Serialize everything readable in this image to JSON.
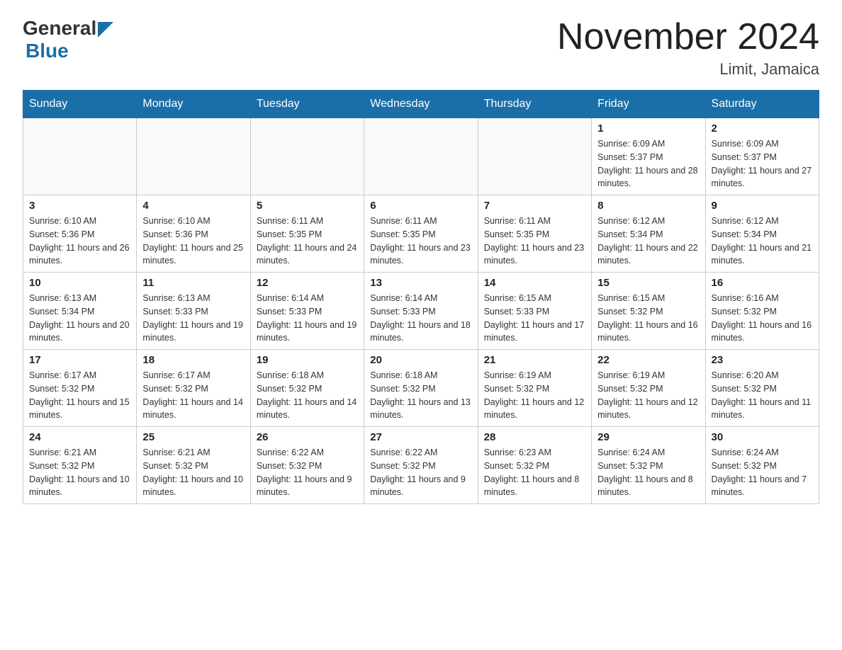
{
  "header": {
    "logo_general": "General",
    "logo_blue": "Blue",
    "month_title": "November 2024",
    "location": "Limit, Jamaica"
  },
  "weekdays": [
    "Sunday",
    "Monday",
    "Tuesday",
    "Wednesday",
    "Thursday",
    "Friday",
    "Saturday"
  ],
  "weeks": [
    [
      {
        "day": "",
        "sunrise": "",
        "sunset": "",
        "daylight": ""
      },
      {
        "day": "",
        "sunrise": "",
        "sunset": "",
        "daylight": ""
      },
      {
        "day": "",
        "sunrise": "",
        "sunset": "",
        "daylight": ""
      },
      {
        "day": "",
        "sunrise": "",
        "sunset": "",
        "daylight": ""
      },
      {
        "day": "",
        "sunrise": "",
        "sunset": "",
        "daylight": ""
      },
      {
        "day": "1",
        "sunrise": "Sunrise: 6:09 AM",
        "sunset": "Sunset: 5:37 PM",
        "daylight": "Daylight: 11 hours and 28 minutes."
      },
      {
        "day": "2",
        "sunrise": "Sunrise: 6:09 AM",
        "sunset": "Sunset: 5:37 PM",
        "daylight": "Daylight: 11 hours and 27 minutes."
      }
    ],
    [
      {
        "day": "3",
        "sunrise": "Sunrise: 6:10 AM",
        "sunset": "Sunset: 5:36 PM",
        "daylight": "Daylight: 11 hours and 26 minutes."
      },
      {
        "day": "4",
        "sunrise": "Sunrise: 6:10 AM",
        "sunset": "Sunset: 5:36 PM",
        "daylight": "Daylight: 11 hours and 25 minutes."
      },
      {
        "day": "5",
        "sunrise": "Sunrise: 6:11 AM",
        "sunset": "Sunset: 5:35 PM",
        "daylight": "Daylight: 11 hours and 24 minutes."
      },
      {
        "day": "6",
        "sunrise": "Sunrise: 6:11 AM",
        "sunset": "Sunset: 5:35 PM",
        "daylight": "Daylight: 11 hours and 23 minutes."
      },
      {
        "day": "7",
        "sunrise": "Sunrise: 6:11 AM",
        "sunset": "Sunset: 5:35 PM",
        "daylight": "Daylight: 11 hours and 23 minutes."
      },
      {
        "day": "8",
        "sunrise": "Sunrise: 6:12 AM",
        "sunset": "Sunset: 5:34 PM",
        "daylight": "Daylight: 11 hours and 22 minutes."
      },
      {
        "day": "9",
        "sunrise": "Sunrise: 6:12 AM",
        "sunset": "Sunset: 5:34 PM",
        "daylight": "Daylight: 11 hours and 21 minutes."
      }
    ],
    [
      {
        "day": "10",
        "sunrise": "Sunrise: 6:13 AM",
        "sunset": "Sunset: 5:34 PM",
        "daylight": "Daylight: 11 hours and 20 minutes."
      },
      {
        "day": "11",
        "sunrise": "Sunrise: 6:13 AM",
        "sunset": "Sunset: 5:33 PM",
        "daylight": "Daylight: 11 hours and 19 minutes."
      },
      {
        "day": "12",
        "sunrise": "Sunrise: 6:14 AM",
        "sunset": "Sunset: 5:33 PM",
        "daylight": "Daylight: 11 hours and 19 minutes."
      },
      {
        "day": "13",
        "sunrise": "Sunrise: 6:14 AM",
        "sunset": "Sunset: 5:33 PM",
        "daylight": "Daylight: 11 hours and 18 minutes."
      },
      {
        "day": "14",
        "sunrise": "Sunrise: 6:15 AM",
        "sunset": "Sunset: 5:33 PM",
        "daylight": "Daylight: 11 hours and 17 minutes."
      },
      {
        "day": "15",
        "sunrise": "Sunrise: 6:15 AM",
        "sunset": "Sunset: 5:32 PM",
        "daylight": "Daylight: 11 hours and 16 minutes."
      },
      {
        "day": "16",
        "sunrise": "Sunrise: 6:16 AM",
        "sunset": "Sunset: 5:32 PM",
        "daylight": "Daylight: 11 hours and 16 minutes."
      }
    ],
    [
      {
        "day": "17",
        "sunrise": "Sunrise: 6:17 AM",
        "sunset": "Sunset: 5:32 PM",
        "daylight": "Daylight: 11 hours and 15 minutes."
      },
      {
        "day": "18",
        "sunrise": "Sunrise: 6:17 AM",
        "sunset": "Sunset: 5:32 PM",
        "daylight": "Daylight: 11 hours and 14 minutes."
      },
      {
        "day": "19",
        "sunrise": "Sunrise: 6:18 AM",
        "sunset": "Sunset: 5:32 PM",
        "daylight": "Daylight: 11 hours and 14 minutes."
      },
      {
        "day": "20",
        "sunrise": "Sunrise: 6:18 AM",
        "sunset": "Sunset: 5:32 PM",
        "daylight": "Daylight: 11 hours and 13 minutes."
      },
      {
        "day": "21",
        "sunrise": "Sunrise: 6:19 AM",
        "sunset": "Sunset: 5:32 PM",
        "daylight": "Daylight: 11 hours and 12 minutes."
      },
      {
        "day": "22",
        "sunrise": "Sunrise: 6:19 AM",
        "sunset": "Sunset: 5:32 PM",
        "daylight": "Daylight: 11 hours and 12 minutes."
      },
      {
        "day": "23",
        "sunrise": "Sunrise: 6:20 AM",
        "sunset": "Sunset: 5:32 PM",
        "daylight": "Daylight: 11 hours and 11 minutes."
      }
    ],
    [
      {
        "day": "24",
        "sunrise": "Sunrise: 6:21 AM",
        "sunset": "Sunset: 5:32 PM",
        "daylight": "Daylight: 11 hours and 10 minutes."
      },
      {
        "day": "25",
        "sunrise": "Sunrise: 6:21 AM",
        "sunset": "Sunset: 5:32 PM",
        "daylight": "Daylight: 11 hours and 10 minutes."
      },
      {
        "day": "26",
        "sunrise": "Sunrise: 6:22 AM",
        "sunset": "Sunset: 5:32 PM",
        "daylight": "Daylight: 11 hours and 9 minutes."
      },
      {
        "day": "27",
        "sunrise": "Sunrise: 6:22 AM",
        "sunset": "Sunset: 5:32 PM",
        "daylight": "Daylight: 11 hours and 9 minutes."
      },
      {
        "day": "28",
        "sunrise": "Sunrise: 6:23 AM",
        "sunset": "Sunset: 5:32 PM",
        "daylight": "Daylight: 11 hours and 8 minutes."
      },
      {
        "day": "29",
        "sunrise": "Sunrise: 6:24 AM",
        "sunset": "Sunset: 5:32 PM",
        "daylight": "Daylight: 11 hours and 8 minutes."
      },
      {
        "day": "30",
        "sunrise": "Sunrise: 6:24 AM",
        "sunset": "Sunset: 5:32 PM",
        "daylight": "Daylight: 11 hours and 7 minutes."
      }
    ]
  ]
}
